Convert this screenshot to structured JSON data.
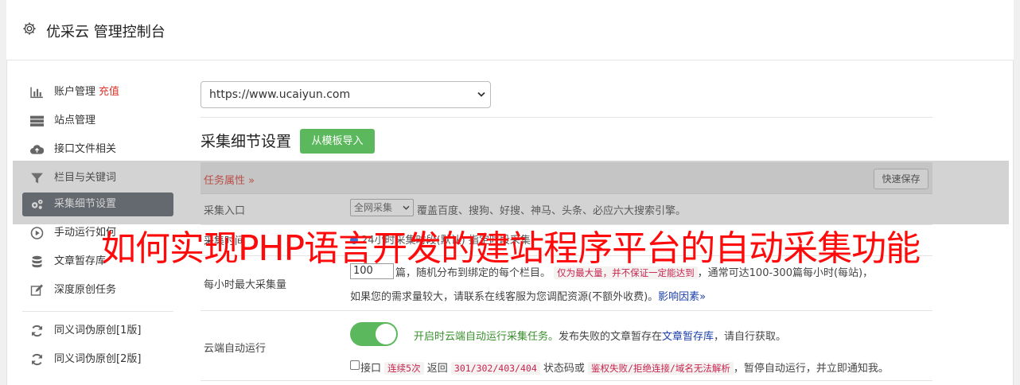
{
  "header": {
    "title": "优采云 管理控制台",
    "icon": "gear-icon"
  },
  "sidebar": {
    "items": [
      {
        "label": "账户管理",
        "extra": "充值",
        "icon": "bar-chart-icon"
      },
      {
        "label": "站点管理",
        "icon": "server-icon"
      },
      {
        "label": "接口文件相关",
        "icon": "cloud-upload-icon"
      },
      {
        "label": "栏目与关键词",
        "icon": "filter-icon"
      },
      {
        "label": "采集细节设置",
        "icon": "cogs-icon",
        "active": true
      },
      {
        "label": "手动运行如何",
        "icon": "play-circle-icon"
      },
      {
        "label": "文章暂存库",
        "icon": "database-icon"
      },
      {
        "label": "深度原创任务",
        "icon": "edit-icon"
      },
      {
        "label": "同义词伪原创[1版]",
        "icon": "refresh-icon"
      },
      {
        "label": "同义词伪原创[2版]",
        "icon": "refresh-icon"
      }
    ]
  },
  "site_select": {
    "value": "https://www.ucaiyun.com"
  },
  "section": {
    "title": "采集细节设置",
    "import_button": "从模板导入"
  },
  "task_bar": {
    "label": "任务属性",
    "quick_save": "快速保存"
  },
  "rows": {
    "entry": {
      "label": "采集入口",
      "select_value": "全网采集",
      "desc": "覆盖百度、搜狗、好搜、神马、头条、必应六大搜索引擎。"
    },
    "mode": {
      "label": "采集时间",
      "partial_text": "24小时采集时段(默认) 指定时段采集"
    },
    "max": {
      "label": "每小时最大采集量",
      "value": "100",
      "t1": "篇，随机分布到绑定的每个栏目。",
      "code1": "仅为最大量，并不保证一定能达到",
      "t2": "，通常可达100-300篇每小时(每站)，",
      "t3": "如果您的需求量较大，请联系在线客服为您调配资源(不额外收费)。",
      "link": "影响因素"
    },
    "cloud": {
      "label": "云端自动运行",
      "enabled_text": "开启时云端自动运行采集任务。",
      "t1": "发布失败的文章暂存在",
      "link": "文章暂存库",
      "t2": "，请自行获取。",
      "c_label": "接口",
      "code1": "连续5次",
      "t3": "返回",
      "code2": "301/302/403/404",
      "t4": "状态码或",
      "code3": "鉴权失败/拒绝连接/域名无法解析",
      "t5": "，暂停自动运行，并立即通知我。"
    }
  },
  "watermark": "如何实现PHP语言开发的建站程序平台的自动采集功能",
  "colors": {
    "accent_green": "#5cb85c",
    "active_item": "#555b66",
    "red": "#d9342b",
    "watermark": "#ff0a0a"
  }
}
